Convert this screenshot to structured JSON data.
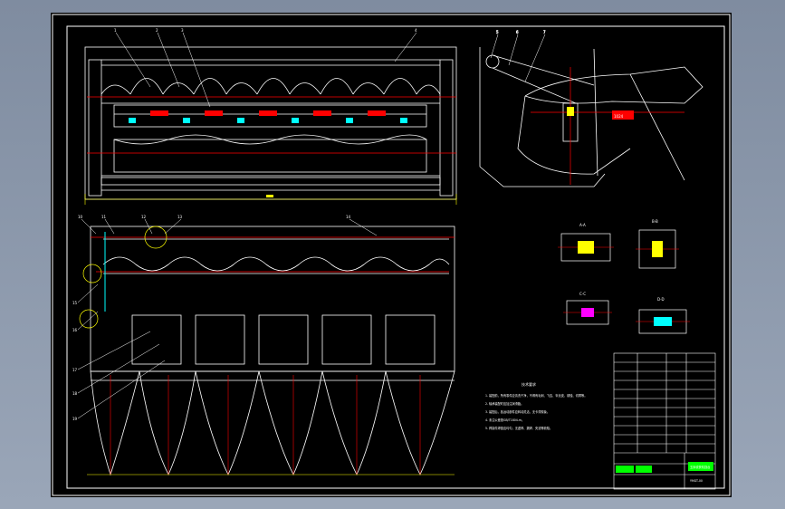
{
  "colors": {
    "background": "#8a96a8",
    "sheet": "#000000",
    "outline": "#ffffff",
    "centerline": "#ff0000",
    "accent_yellow": "#ffff00",
    "accent_cyan": "#00ffff",
    "accent_green": "#00ff00",
    "accent_magenta": "#ff00ff"
  },
  "views": {
    "top_front": {
      "leader_labels": [
        "1",
        "2",
        "3",
        "4"
      ]
    },
    "side_view": {
      "leader_labels": [
        "5",
        "6",
        "7"
      ],
      "chain_label": "1024"
    },
    "plan_view": {
      "leader_labels": [
        "10",
        "11",
        "12",
        "13",
        "14",
        "15",
        "16",
        "17",
        "18",
        "19"
      ]
    },
    "details": {
      "section_labels": [
        "A-A",
        "B-B",
        "C-C",
        "D-D"
      ]
    }
  },
  "technical_requirements": {
    "title": "技术要求",
    "items": [
      "1. 装配前，所有零件应清洗干净，不得有毛刺、飞边、氧化皮、锈蚀、切屑等。",
      "2. 轴承装配时应加注润滑脂。",
      "3. 装配后，各运动部件应转动灵活，无卡滞现象。",
      "4. 未注公差按GB/T1804-m。",
      "5. 焊接件焊缝应均匀，无虚焊、漏焊、夹渣等缺陷。"
    ]
  },
  "title_block": {
    "name": "玉米收获机割台",
    "drawing_no": "YMGT-00"
  }
}
